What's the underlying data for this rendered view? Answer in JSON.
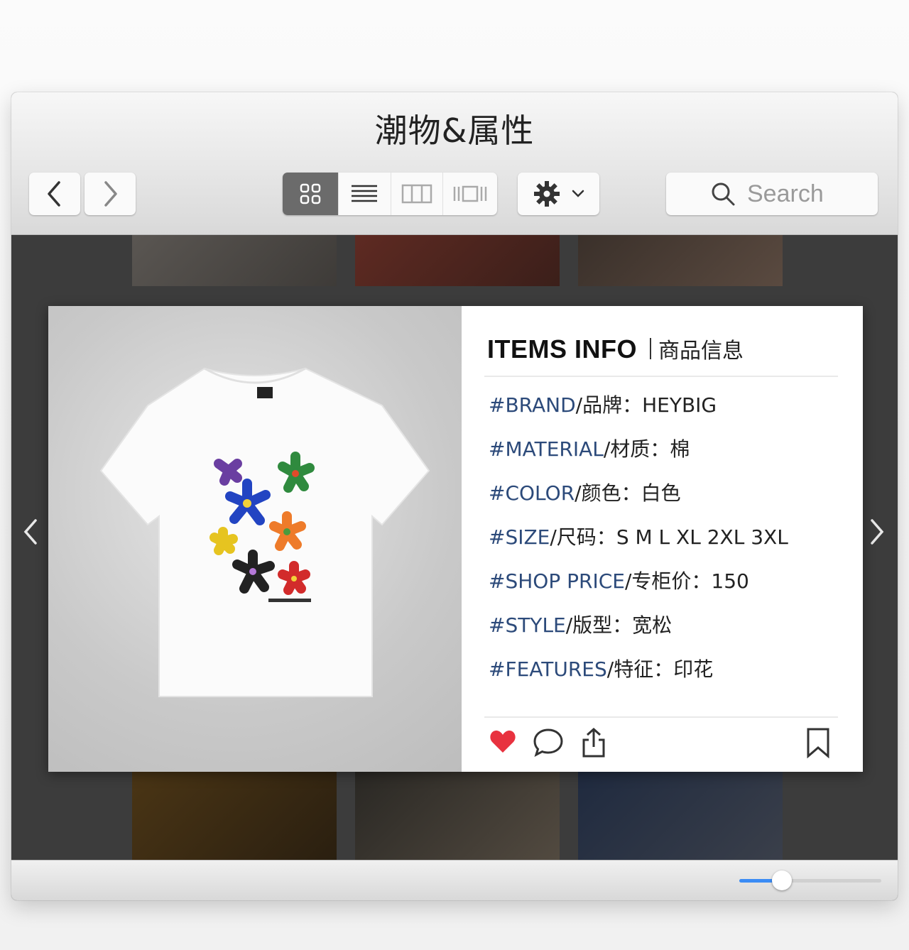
{
  "window": {
    "title": "潮物&属性"
  },
  "toolbar": {
    "back_icon": "chevron-left-icon",
    "forward_icon": "chevron-right-icon",
    "view_modes": [
      "grid-view-icon",
      "list-view-icon",
      "column-view-icon",
      "coverflow-view-icon"
    ],
    "active_view": "grid",
    "settings_icon": "gear-icon",
    "search_placeholder": "Search"
  },
  "card": {
    "title_en": "ITEMS INFO",
    "title_cn": "商品信息",
    "rows": [
      {
        "key": "#BRAND",
        "label": "/品牌：",
        "value": "HEYBIG"
      },
      {
        "key": "#MATERIAL",
        "label": "/材质：",
        "value": "棉"
      },
      {
        "key": "#COLOR",
        "label": "/颜色：",
        "value": "白色"
      },
      {
        "key": "#SIZE",
        "label": "/尺码：",
        "value": "S M L XL 2XL 3XL"
      },
      {
        "key": "#SHOP PRICE",
        "label": "/专柜价：",
        "value": "150"
      },
      {
        "key": "#STYLE",
        "label": "/版型：",
        "value": "宽松"
      },
      {
        "key": "#FEATURES",
        "label": "/特征：",
        "value": "印花"
      }
    ],
    "product_image": "white-tshirt-flower-print",
    "liked": true
  },
  "colors": {
    "heart": "#e8323f",
    "key_text": "#2c4a7a",
    "slider": "#3b8cf5"
  },
  "zoom_slider": {
    "value": 0.3
  }
}
